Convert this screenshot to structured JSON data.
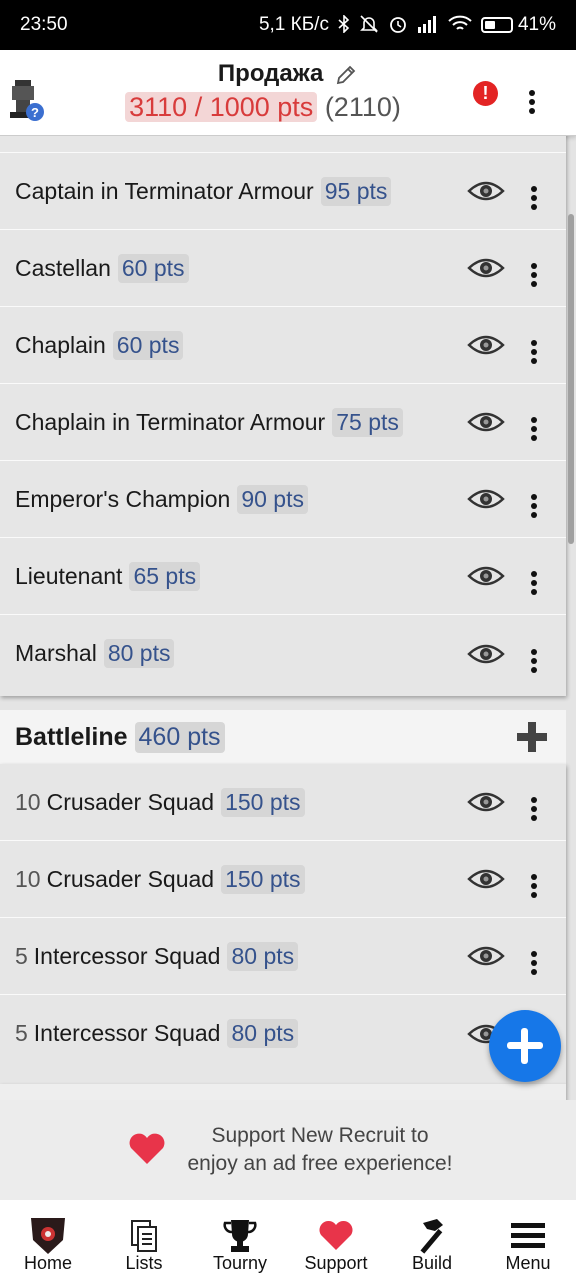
{
  "status_bar": {
    "time": "23:50",
    "network_speed": "5,1 КБ/с",
    "battery": "41%",
    "icons": [
      "bluetooth-icon",
      "mute-icon",
      "alarm-icon",
      "signal-icon",
      "wifi-icon",
      "battery-icon"
    ]
  },
  "header": {
    "title": "Продажа",
    "points_over": "3110 / 1000 pts",
    "points_diff": "(2110)",
    "alert_glyph": "!",
    "help_glyph": "?"
  },
  "hq_units": [
    {
      "name": "Captain in Terminator Armour",
      "pts": "95 pts"
    },
    {
      "name": "Castellan",
      "pts": "60 pts"
    },
    {
      "name": "Chaplain",
      "pts": "60 pts"
    },
    {
      "name": "Chaplain in Terminator Armour",
      "pts": "75 pts"
    },
    {
      "name": "Emperor's Champion",
      "pts": "90 pts"
    },
    {
      "name": "Lieutenant",
      "pts": "65 pts"
    },
    {
      "name": "Marshal",
      "pts": "80 pts"
    }
  ],
  "battleline": {
    "title": "Battleline",
    "pts": "460 pts",
    "units": [
      {
        "count": "10",
        "name": "Crusader Squad",
        "pts": "150 pts"
      },
      {
        "count": "10",
        "name": "Crusader Squad",
        "pts": "150 pts"
      },
      {
        "count": "5",
        "name": "Intercessor Squad",
        "pts": "80 pts"
      },
      {
        "count": "5",
        "name": "Intercessor Squad",
        "pts": "80 pts"
      }
    ]
  },
  "ad": {
    "line1": "Support New Recruit to",
    "line2": "enjoy an ad free experience!"
  },
  "nav": {
    "home": "Home",
    "lists": "Lists",
    "tourny": "Tourny",
    "support": "Support",
    "build": "Build",
    "menu": "Menu"
  },
  "colors": {
    "accent": "#1677e8",
    "points_text": "#35528c",
    "over_limit": "#d83b3b",
    "heart": "#e8344a"
  }
}
